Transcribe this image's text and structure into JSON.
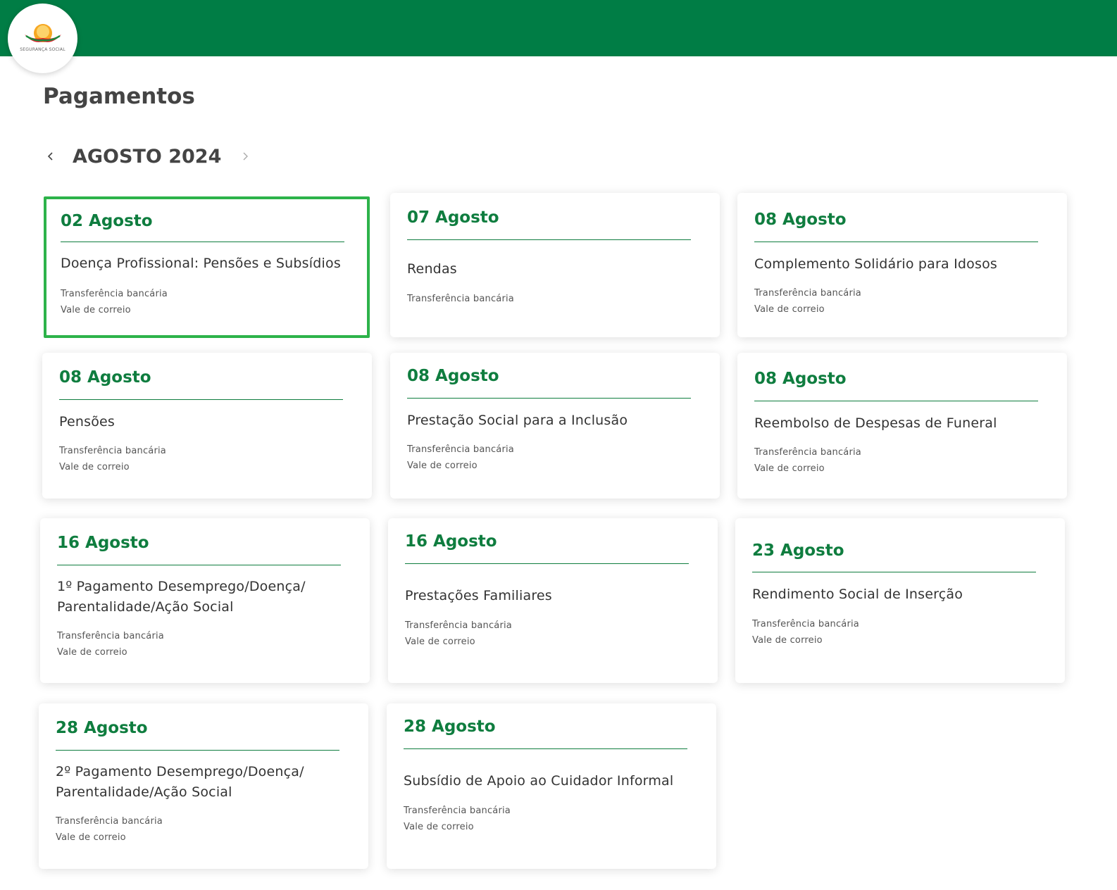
{
  "header": {
    "logo_text": "SEGURANÇA SOCIAL",
    "color": "#007d45"
  },
  "page": {
    "title": "Pagamentos"
  },
  "month_nav": {
    "label": "AGOSTO 2024",
    "prev_icon": "chevron-left-icon",
    "next_icon": "chevron-right-icon"
  },
  "accent_color": "#0f7d3f",
  "selected_border_color": "#2db34a",
  "payments": [
    {
      "date": "02 Agosto",
      "title_lines": [
        "Doença Profissional: Pensões e Subsídios"
      ],
      "methods": [
        "Transferência bancária",
        "Vale de correio"
      ],
      "selected": true
    },
    {
      "date": "07 Agosto",
      "title_lines": [
        "Rendas"
      ],
      "methods": [
        "Transferência bancária"
      ]
    },
    {
      "date": "08 Agosto",
      "title_lines": [
        "Complemento Solidário para Idosos"
      ],
      "methods": [
        "Transferência bancária",
        "Vale de correio"
      ]
    },
    {
      "date": "08 Agosto",
      "title_lines": [
        "Pensões"
      ],
      "methods": [
        "Transferência bancária",
        "Vale de correio"
      ]
    },
    {
      "date": "08 Agosto",
      "title_lines": [
        "Prestação Social para a Inclusão"
      ],
      "methods": [
        "Transferência bancária",
        "Vale de correio"
      ]
    },
    {
      "date": "08 Agosto",
      "title_lines": [
        "Reembolso de Despesas de Funeral"
      ],
      "methods": [
        "Transferência bancária",
        "Vale de correio"
      ]
    },
    {
      "date": "16 Agosto",
      "title_lines": [
        "1º Pagamento Desemprego/Doença/",
        "Parentalidade/Ação Social"
      ],
      "methods": [
        "Transferência bancária",
        "Vale de correio"
      ]
    },
    {
      "date": "16 Agosto",
      "title_lines": [
        "Prestações Familiares"
      ],
      "methods": [
        "Transferência bancária",
        "Vale de correio"
      ]
    },
    {
      "date": "23 Agosto",
      "title_lines": [
        "Rendimento Social de Inserção"
      ],
      "methods": [
        "Transferência bancária",
        "Vale de correio"
      ]
    },
    {
      "date": "28 Agosto",
      "title_lines": [
        "2º Pagamento Desemprego/Doença/",
        "Parentalidade/Ação Social"
      ],
      "methods": [
        "Transferência bancária",
        "Vale de correio"
      ]
    },
    {
      "date": "28 Agosto",
      "title_lines": [
        "Subsídio de Apoio ao Cuidador Informal"
      ],
      "methods": [
        "Transferência bancária",
        "Vale de correio"
      ]
    }
  ]
}
